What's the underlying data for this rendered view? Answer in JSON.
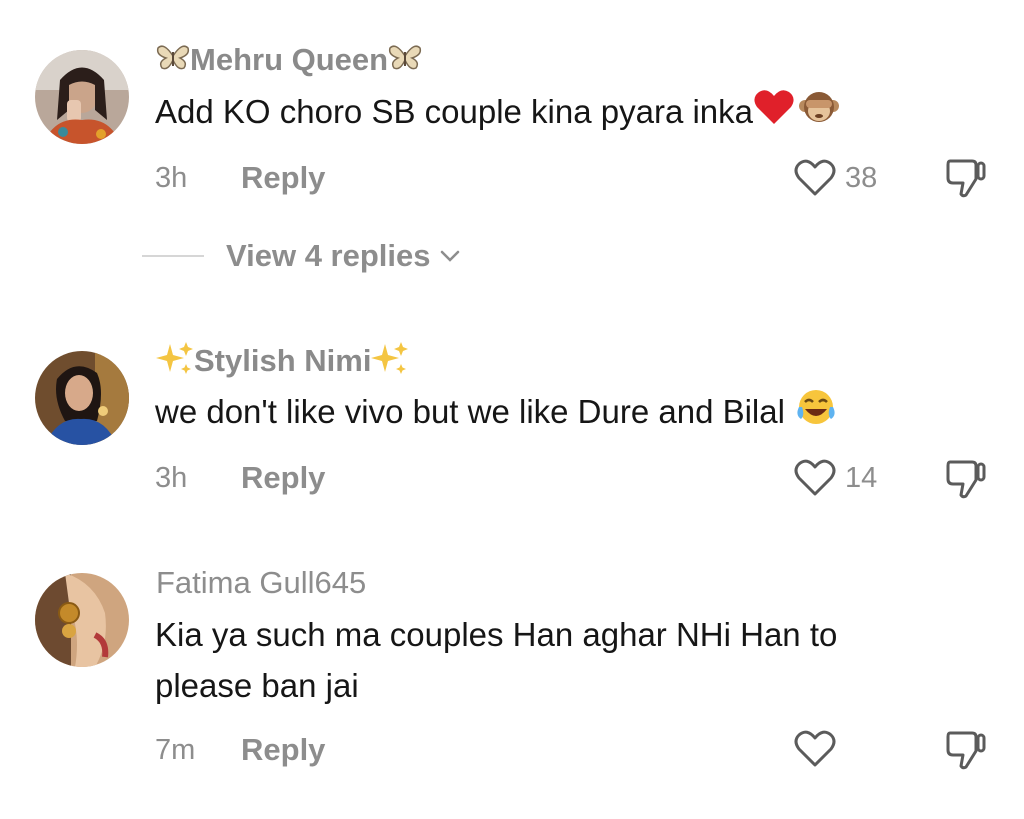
{
  "comments": [
    {
      "username": "Mehru Queen",
      "username_prefix_icon": "butterfly-icon",
      "username_suffix_icon": "butterfly-icon",
      "text": "Add KO choro SB couple kina pyara inka",
      "text_emojis": [
        "red-heart-emoji",
        "see-no-evil-monkey-emoji"
      ],
      "time": "3h",
      "reply_label": "Reply",
      "likes": "38",
      "view_replies_label": "View 4 replies"
    },
    {
      "username": "Stylish Nimi",
      "username_prefix_icon": "sparkles-icon",
      "username_suffix_icon": "sparkles-icon",
      "text": "we don't like vivo but we like Dure and Bilal",
      "text_emojis": [
        "tears-of-joy-emoji"
      ],
      "time": "3h",
      "reply_label": "Reply",
      "likes": "14"
    },
    {
      "username": "Fatima Gull645",
      "text": "Kia ya such ma couples Han aghar NHi Han to please ban jai",
      "time": "7m",
      "reply_label": "Reply",
      "likes": ""
    }
  ],
  "colors": {
    "muted_text": "#8d8d8d",
    "body_text": "#161616",
    "heart_emoji": "#e0202a",
    "sparkle": "#f4c542"
  }
}
